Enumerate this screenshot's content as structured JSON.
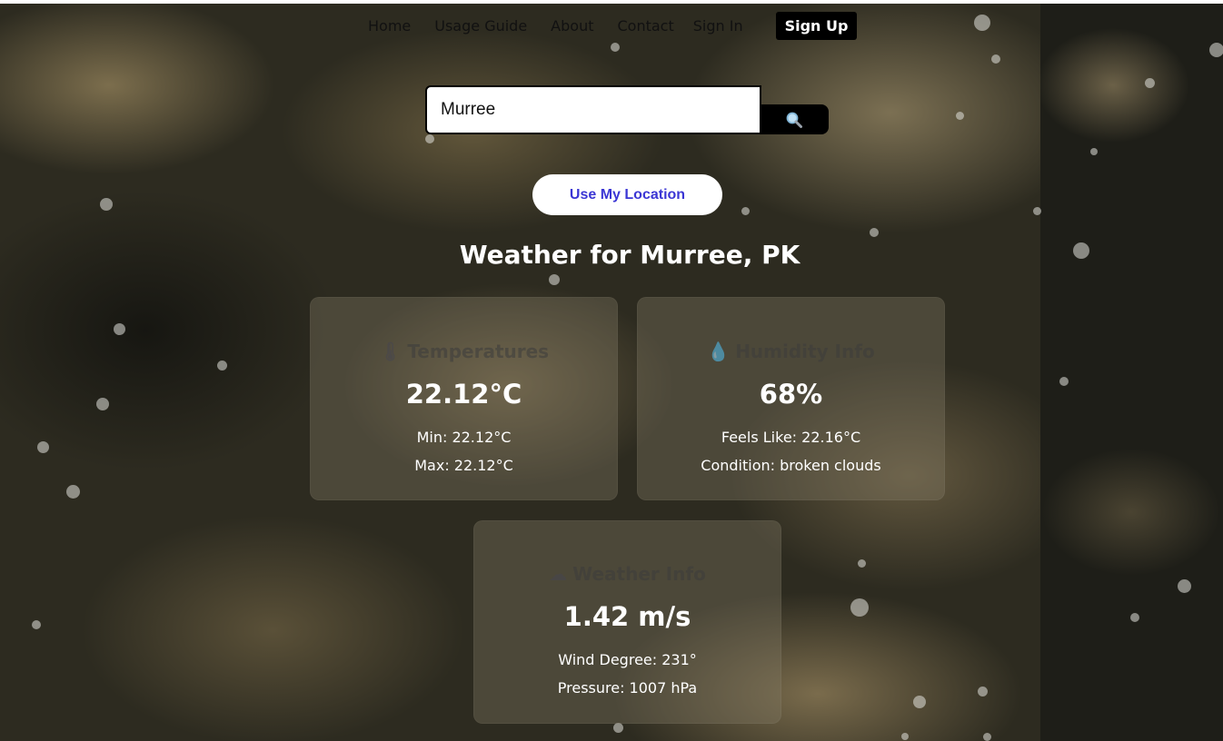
{
  "nav": {
    "home": "Home",
    "usage_guide": "Usage Guide",
    "about": "About",
    "contact": "Contact",
    "sign_in": "Sign In",
    "sign_up": "Sign Up"
  },
  "search": {
    "value": "Murree",
    "button_icon": "search-icon"
  },
  "location_button": "Use My Location",
  "page_title": "Weather for Murree, PK",
  "cards": {
    "temperature": {
      "heading": "Temperatures",
      "icon": "thermometer-icon",
      "value": "22.12°C",
      "line1": "Min: 22.12°C",
      "line2": "Max: 22.12°C"
    },
    "humidity": {
      "heading": "Humidity Info",
      "icon": "droplet-icon",
      "value": "68%",
      "line1": "Feels Like: 22.16°C",
      "line2": "Condition: broken clouds"
    },
    "weather": {
      "heading": "Weather Info",
      "icon": "cloud-icon",
      "value": "1.42 m/s",
      "line1": "Wind Degree: 231°",
      "line2": "Pressure: 1007 hPa"
    }
  },
  "colors": {
    "accent": "#3b36d4",
    "signup_bg": "#000000"
  }
}
